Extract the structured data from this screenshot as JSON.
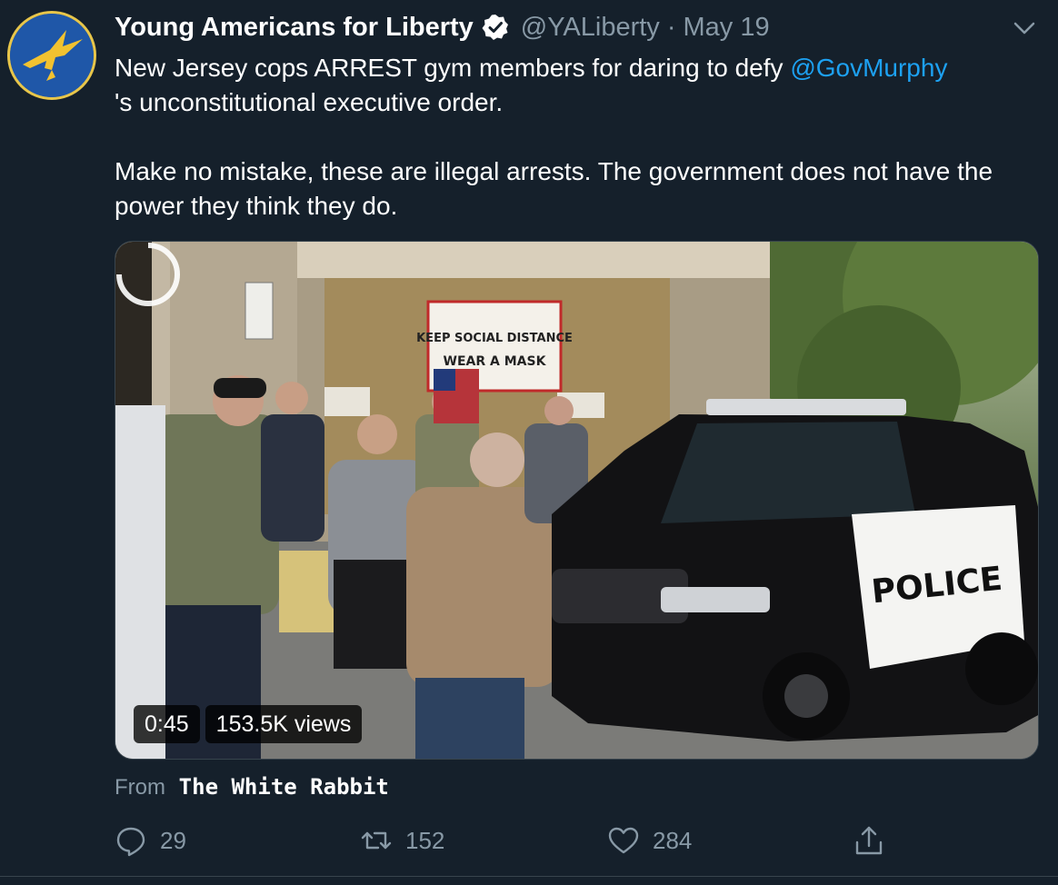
{
  "tweet": {
    "author_name": "Young Americans for Liberty",
    "handle": "@YALiberty",
    "separator": "·",
    "date": "May 19",
    "text_part1": "New Jersey cops ARREST gym members for daring to defy ",
    "mention": "@GovMurphy",
    "text_part2": "'s unconstitutional executive order.",
    "text_paragraph2": "Make no mistake, these are illegal arrests. The government does not have the power they think they do."
  },
  "media": {
    "duration": "0:45",
    "views": "153.5K views",
    "sign_text_line1": "KEEP SOCIAL DISTANCE",
    "sign_text_line2": "WEAR A MASK",
    "police_text": "POLICE"
  },
  "attribution": {
    "prefix": "From",
    "source": "The White Rabbit"
  },
  "actions": {
    "reply_count": "29",
    "retweet_count": "152",
    "like_count": "284"
  },
  "colors": {
    "background": "#15202b",
    "accent": "#1da1f2",
    "secondary_text": "#8899a6"
  }
}
